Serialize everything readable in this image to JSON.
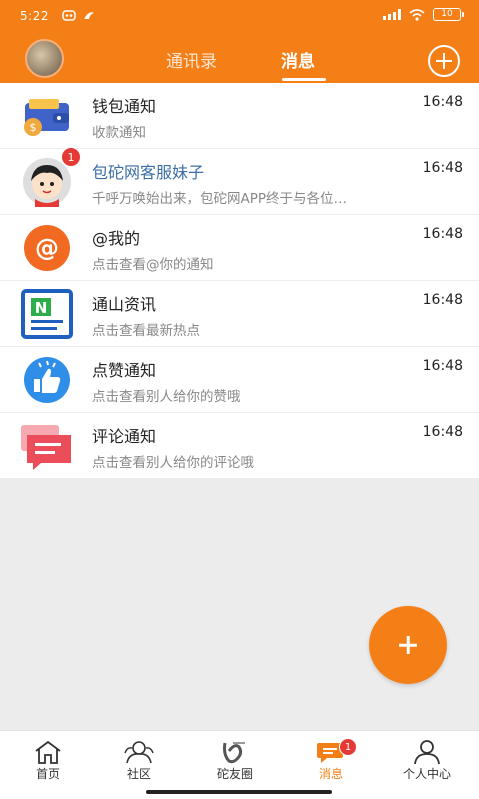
{
  "status_bar": {
    "time": "5:22",
    "battery": "10"
  },
  "header": {
    "tabs": [
      {
        "label": "通讯录"
      },
      {
        "label": "消息"
      }
    ],
    "active_tab": "消息",
    "accent_color": "#f57f17"
  },
  "messages": [
    {
      "title": "钱包通知",
      "subtitle": "收款通知",
      "time": "16:48",
      "icon": "wallet-icon"
    },
    {
      "title": "包砣网客服妹子",
      "subtitle": "千呼万唤始出来，包砣网APP终于与各位…",
      "time": "16:48",
      "icon": "customer-service-avatar",
      "badge": "1"
    },
    {
      "title": "@我的",
      "subtitle": "点击查看@你的通知",
      "time": "16:48",
      "icon": "at-icon"
    },
    {
      "title": "通山资讯",
      "subtitle": "点击查看最新热点",
      "time": "16:48",
      "icon": "news-icon"
    },
    {
      "title": "点赞通知",
      "subtitle": "点击查看别人给你的赞哦",
      "time": "16:48",
      "icon": "thumbs-up-icon"
    },
    {
      "title": "评论通知",
      "subtitle": "点击查看别人给你的评论哦",
      "time": "16:48",
      "icon": "comment-icon"
    }
  ],
  "bottom_nav": [
    {
      "label": "首页",
      "icon": "home-icon"
    },
    {
      "label": "社区",
      "icon": "community-icon"
    },
    {
      "label": "砣友圈",
      "icon": "friends-circle-icon"
    },
    {
      "label": "消息",
      "icon": "message-icon",
      "badge": "1",
      "active": true
    },
    {
      "label": "个人中心",
      "icon": "person-icon"
    }
  ]
}
